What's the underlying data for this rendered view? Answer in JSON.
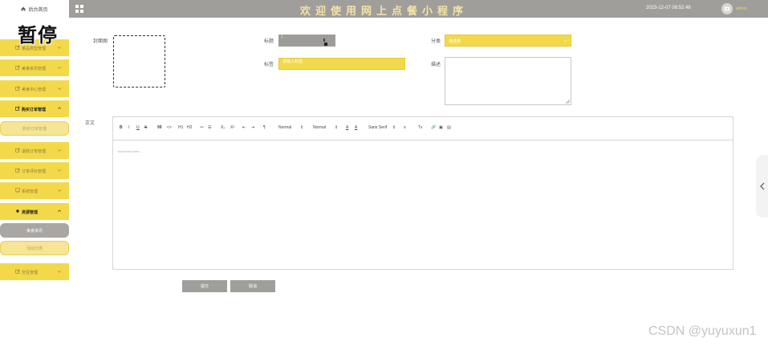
{
  "header": {
    "home_label": "后台首页",
    "title": "欢迎使用网上点餐小程序",
    "datetime": "2023-12-07 08:52:48",
    "username": "admin",
    "colors": {
      "bar": "#a09e9b",
      "title": "#f4e3a6",
      "accent": "#f4d94c"
    }
  },
  "overlay": {
    "pause_text": "暂停"
  },
  "sidebar": {
    "menu": [
      {
        "label": "菜品类型管理",
        "icon": "edit-icon"
      },
      {
        "label": "美食资讯管理",
        "icon": "edit-icon"
      },
      {
        "label": "美食中心管理",
        "icon": "edit-icon"
      },
      {
        "label": "购买订单管理",
        "icon": "edit-icon",
        "active": true
      },
      {
        "label": "退款订单管理",
        "icon": "edit-icon"
      },
      {
        "label": "订单评价管理",
        "icon": "edit-icon"
      },
      {
        "label": "系统管理",
        "icon": "monitor-icon"
      },
      {
        "label": "资源管理",
        "icon": "location-icon",
        "active": true
      },
      {
        "label": "交互管理",
        "icon": "edit-icon"
      }
    ],
    "submenu_orders": "购买订单管理",
    "submenu_resources": [
      "美食资讯",
      "活动分类"
    ],
    "accent_color": "#f3d94a"
  },
  "form": {
    "cover_label": "封面图",
    "title_label": "标题",
    "title_value": "|",
    "category_label": "分类",
    "category_value": "请选择",
    "tags_label": "标签",
    "tags_placeholder": "请输入标签",
    "desc_label": "描述",
    "content_label": "正文"
  },
  "editor": {
    "toolbar": {
      "bold": "B",
      "italic": "I",
      "underline": "U",
      "strike": "S",
      "quote": "99",
      "code": "<>",
      "h1": "H1",
      "h2": "H2",
      "ordered_list": "≔",
      "bullet_list": "☰",
      "subscript": "X₂",
      "superscript": "X²",
      "outdent": "⇤",
      "indent": "⇥",
      "direction": "¶",
      "size": "Normal",
      "header": "Normal",
      "font_color": "A",
      "background_color": "A",
      "font": "Sans Serif",
      "align": "≡",
      "clean": "Tx",
      "link": "🔗",
      "image": "▣",
      "video": "▤"
    },
    "placeholder": "Insert text here ..."
  },
  "buttons": {
    "submit": "提交",
    "cancel": "取消"
  },
  "watermark": "CSDN @yuyuxun1"
}
